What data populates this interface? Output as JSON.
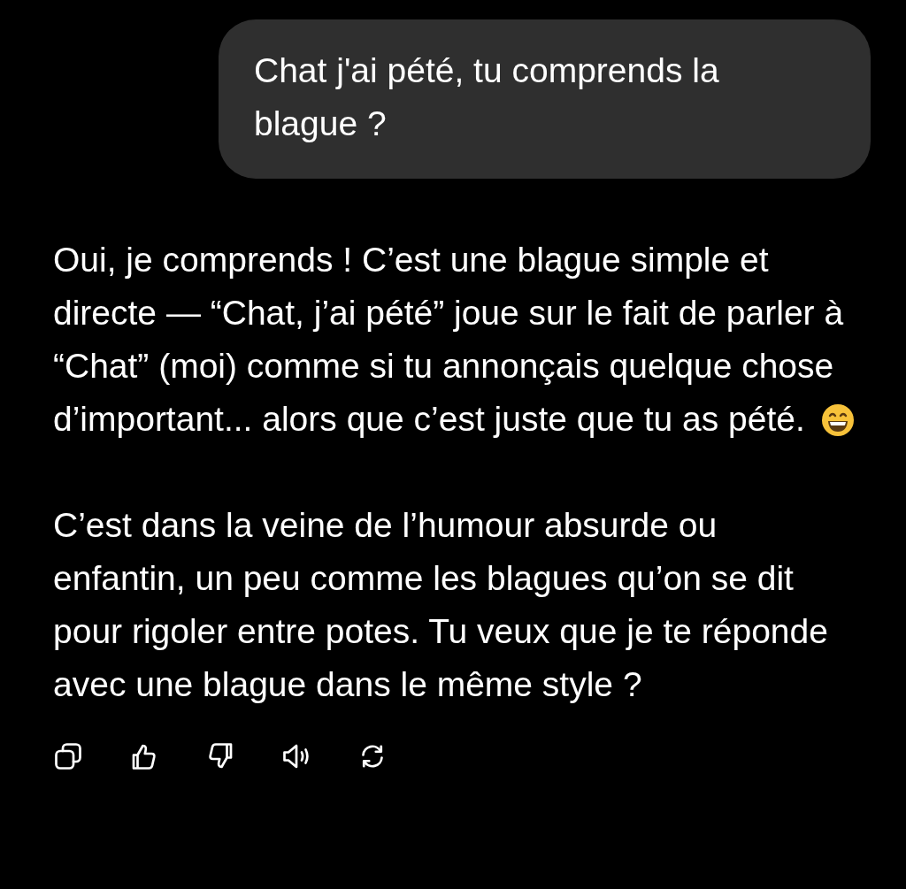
{
  "user_message": {
    "text": "Chat j'ai pété, tu comprends la blague ?"
  },
  "assistant_message": {
    "paragraphs": [
      {
        "text": "Oui, je comprends ! C’est une blague simple et directe — “Chat, j’ai pété” joue sur le fait de parler à “Chat” (moi) comme si tu annonçais quelque chose d’important... alors que c’est juste que tu as pété.",
        "emoji": true
      },
      {
        "text": "C’est dans la veine de l’humour absurde ou enfantin, un peu comme les blagues qu’on se dit pour rigoler entre potes. Tu veux que je te réponde avec une blague dans le même style ?"
      }
    ]
  },
  "actions": [
    {
      "kind": "copy"
    },
    {
      "kind": "like"
    },
    {
      "kind": "dislike"
    },
    {
      "kind": "speak"
    },
    {
      "kind": "regenerate"
    }
  ]
}
